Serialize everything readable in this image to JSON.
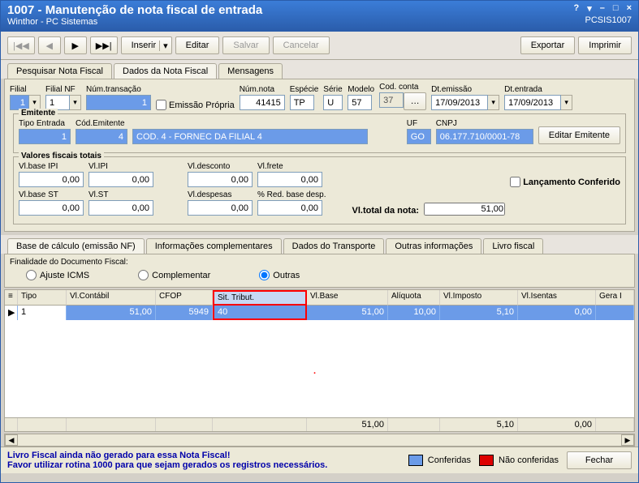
{
  "title": {
    "main": "1007 - Manutenção de nota fiscal de entrada",
    "sub": "Winthor - PC Sistemas",
    "code": "PCSIS1007"
  },
  "toolbar": {
    "inserir": "Inserir",
    "editar": "Editar",
    "salvar": "Salvar",
    "cancelar": "Cancelar",
    "exportar": "Exportar",
    "imprimir": "Imprimir"
  },
  "tabs1": {
    "a": "Pesquisar Nota Fiscal",
    "b": "Dados da Nota Fiscal",
    "c": "Mensagens"
  },
  "header": {
    "filial_lbl": "Filial",
    "filial": "1",
    "filialnf_lbl": "Filial NF",
    "filialnf": "1",
    "numtrans_lbl": "Núm.transação",
    "numtrans": "1",
    "emissao_propria": "Emissão Própria",
    "numnota_lbl": "Núm.nota",
    "numnota": "41415",
    "especie_lbl": "Espécie",
    "especie": "TP",
    "serie_lbl": "Série",
    "serie": "U",
    "modelo_lbl": "Modelo",
    "modelo": "57",
    "codconta_lbl": "Cod. conta",
    "codconta": "37",
    "dtemissao_lbl": "Dt.emissão",
    "dtemissao": "17/09/2013",
    "dtentrada_lbl": "Dt.entrada",
    "dtentrada": "17/09/2013"
  },
  "emitente": {
    "group": "Emitente",
    "tipoentrada_lbl": "Tipo Entrada",
    "tipoentrada": "1",
    "codemit_lbl": "Cód.Emitente",
    "codemit": "4",
    "desc": "COD. 4 - FORNEC DA FILIAL 4",
    "uf_lbl": "UF",
    "uf": "GO",
    "cnpj_lbl": "CNPJ",
    "cnpj": "06.177.710/0001-78",
    "editar_btn": "Editar Emitente"
  },
  "valores": {
    "group": "Valores fiscais totais",
    "vlbaseipi_lbl": "Vl.base IPI",
    "vlbaseipi": "0,00",
    "vlipi_lbl": "Vl.IPI",
    "vlipi": "0,00",
    "vldesconto_lbl": "Vl.desconto",
    "vldesconto": "0,00",
    "vlfrete_lbl": "Vl.frete",
    "vlfrete": "0,00",
    "vlbasest_lbl": "Vl.base ST",
    "vlbasest": "0,00",
    "vlst_lbl": "Vl.ST",
    "vlst": "0,00",
    "vldespesas_lbl": "Vl.despesas",
    "vldespesas": "0,00",
    "redbase_lbl": "% Red. base desp.",
    "redbase": "0,00",
    "total_lbl": "Vl.total da nota:",
    "total": "51,00",
    "lanc_conf": "Lançamento Conferido"
  },
  "tabs2": {
    "a": "Base de cálculo (emissão NF)",
    "b": "Informações complementares",
    "c": "Dados do Transporte",
    "d": "Outras informações",
    "e": "Livro fiscal"
  },
  "finalidade": {
    "lbl": "Finalidade do Documento Fiscal:",
    "a": "Ajuste ICMS",
    "b": "Complementar",
    "c": "Outras"
  },
  "grid": {
    "cols": {
      "tipo": "Tipo",
      "vlcontabil": "Vl.Contábil",
      "cfop": "CFOP",
      "sittribut": "Sit. Tribut.",
      "vlbase": "Vl.Base",
      "aliquota": "Alíquota",
      "vlimposto": "Vl.Imposto",
      "vlisentas": "Vl.Isentas",
      "gera": "Gera I"
    },
    "row": {
      "tipo": "1",
      "vlcontabil": "51,00",
      "cfop": "5949",
      "sittribut": "40",
      "vlbase": "51,00",
      "aliquota": "10,00",
      "vlimposto": "5,10",
      "vlisentas": "0,00"
    },
    "foot": {
      "vlbase": "51,00",
      "vlimposto": "5,10",
      "vlisentas": "0,00"
    }
  },
  "footer": {
    "l1": "Livro Fiscal ainda não gerado para essa Nota Fiscal!",
    "l2": "Favor utilizar rotina 1000 para que sejam gerados os registros necessários.",
    "conferidas": "Conferidas",
    "naoconf": "Não conferidas",
    "fechar": "Fechar"
  }
}
